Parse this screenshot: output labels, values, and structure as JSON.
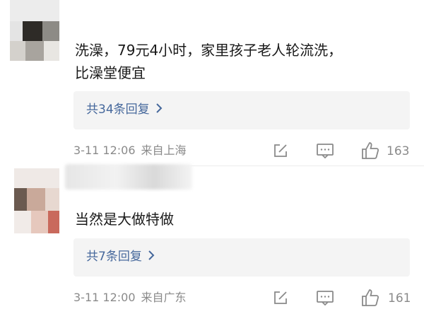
{
  "comments": [
    {
      "content_line1": "洗澡，79元4小时，家里孩子老人轮流洗，",
      "content_line2": "比澡堂便宜",
      "replies_label": "共34条回复",
      "date": "3-11 12:06",
      "location": "来自上海",
      "likes": "163"
    },
    {
      "content_line1": "当然是大做特做",
      "replies_label": "共7条回复",
      "date": "3-11 12:00",
      "location": "来自广东",
      "likes": "161"
    }
  ],
  "icons": {
    "repost": "share-edit-icon",
    "comment": "comment-icon",
    "like": "thumbs-up-icon",
    "chevron": "chevron-right-icon"
  },
  "colors": {
    "link": "#46689c",
    "meta": "#8a8a8a",
    "reply_bg": "#f4f4f4"
  }
}
